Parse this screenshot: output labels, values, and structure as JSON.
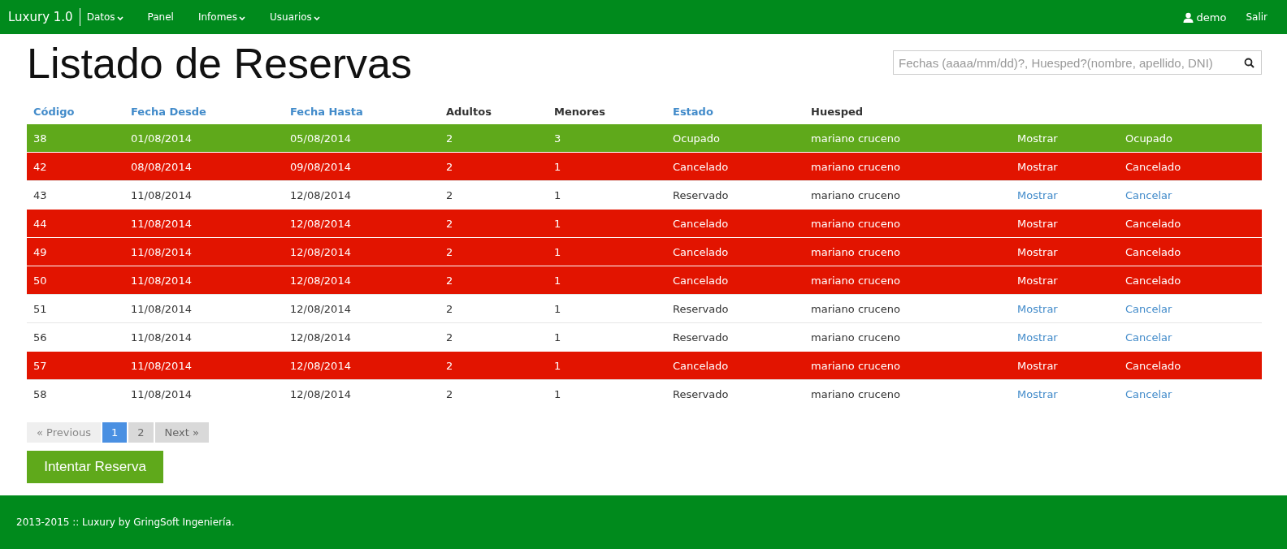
{
  "navbar": {
    "brand": "Luxury 1.0",
    "menu": [
      {
        "label": "Datos",
        "dropdown": true
      },
      {
        "label": "Panel",
        "dropdown": false
      },
      {
        "label": "Infomes",
        "dropdown": true
      },
      {
        "label": "Usuarios",
        "dropdown": true
      }
    ],
    "user": "demo",
    "logout": "Salir"
  },
  "page_title": "Listado de Reservas",
  "search": {
    "placeholder": "Fechas (aaaa/mm/dd)?, Huesped?(nombre, apellido, DNI)"
  },
  "table": {
    "columns": [
      {
        "label": "Código",
        "sortable": true
      },
      {
        "label": "Fecha Desde",
        "sortable": true
      },
      {
        "label": "Fecha Hasta",
        "sortable": true
      },
      {
        "label": "Adultos",
        "sortable": false
      },
      {
        "label": "Menores",
        "sortable": false
      },
      {
        "label": "Estado",
        "sortable": true
      },
      {
        "label": "Huesped",
        "sortable": false
      }
    ],
    "rows": [
      {
        "kind": "ocupado",
        "cells": [
          "38",
          "01/08/2014",
          "05/08/2014",
          "2",
          "3",
          "Ocupado",
          "mariano cruceno"
        ],
        "action_1": "Mostrar",
        "action_2": "Ocupado"
      },
      {
        "kind": "cancelado",
        "cells": [
          "42",
          "08/08/2014",
          "09/08/2014",
          "2",
          "1",
          "Cancelado",
          "mariano cruceno"
        ],
        "action_1": "Mostrar",
        "action_2": "Cancelado"
      },
      {
        "kind": "reservado",
        "cells": [
          "43",
          "11/08/2014",
          "12/08/2014",
          "2",
          "1",
          "Reservado",
          "mariano cruceno"
        ],
        "action_1": "Mostrar",
        "action_2": "Cancelar"
      },
      {
        "kind": "cancelado",
        "cells": [
          "44",
          "11/08/2014",
          "12/08/2014",
          "2",
          "1",
          "Cancelado",
          "mariano cruceno"
        ],
        "action_1": "Mostrar",
        "action_2": "Cancelado"
      },
      {
        "kind": "cancelado",
        "cells": [
          "49",
          "11/08/2014",
          "12/08/2014",
          "2",
          "1",
          "Cancelado",
          "mariano cruceno"
        ],
        "action_1": "Mostrar",
        "action_2": "Cancelado"
      },
      {
        "kind": "cancelado",
        "cells": [
          "50",
          "11/08/2014",
          "12/08/2014",
          "2",
          "1",
          "Cancelado",
          "mariano cruceno"
        ],
        "action_1": "Mostrar",
        "action_2": "Cancelado"
      },
      {
        "kind": "reservado",
        "cells": [
          "51",
          "11/08/2014",
          "12/08/2014",
          "2",
          "1",
          "Reservado",
          "mariano cruceno"
        ],
        "action_1": "Mostrar",
        "action_2": "Cancelar"
      },
      {
        "kind": "reservado",
        "cells": [
          "56",
          "11/08/2014",
          "12/08/2014",
          "2",
          "1",
          "Reservado",
          "mariano cruceno"
        ],
        "action_1": "Mostrar",
        "action_2": "Cancelar"
      },
      {
        "kind": "cancelado",
        "cells": [
          "57",
          "11/08/2014",
          "12/08/2014",
          "2",
          "1",
          "Cancelado",
          "mariano cruceno"
        ],
        "action_1": "Mostrar",
        "action_2": "Cancelado"
      },
      {
        "kind": "reservado",
        "cells": [
          "58",
          "11/08/2014",
          "12/08/2014",
          "2",
          "1",
          "Reservado",
          "mariano cruceno"
        ],
        "action_1": "Mostrar",
        "action_2": "Cancelar"
      }
    ]
  },
  "pagination": {
    "previous": {
      "label": "« Previous",
      "disabled": true
    },
    "pages": [
      {
        "label": "1",
        "selected": true
      },
      {
        "label": "2",
        "selected": false
      }
    ],
    "next": {
      "label": "Next »",
      "disabled": false
    }
  },
  "primary_button": "Intentar Reserva",
  "footer": "2013-2015 :: Luxury by GringSoft Ingeniería."
}
